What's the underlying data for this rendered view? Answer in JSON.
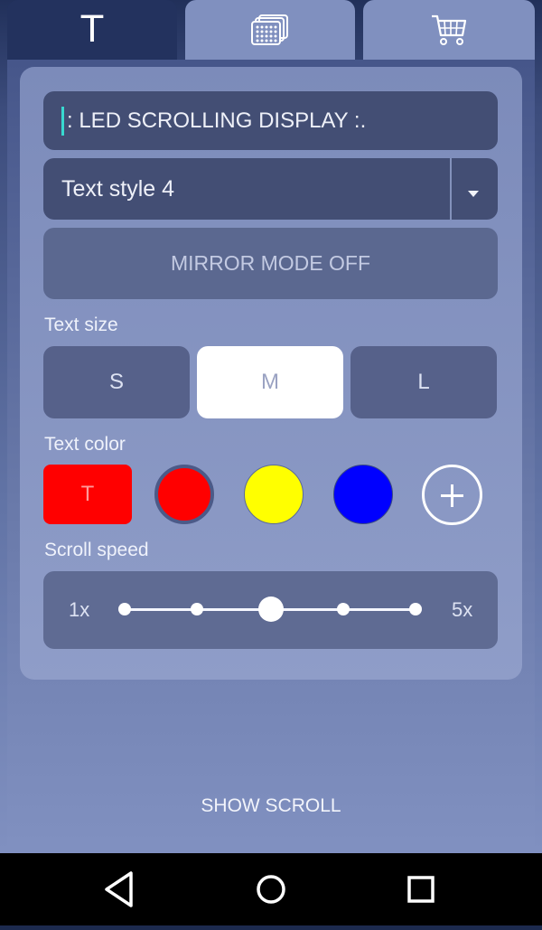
{
  "tabs": [
    {
      "label": "T",
      "icon": "text-icon",
      "active": true
    },
    {
      "label": "",
      "icon": "led-matrix-icon",
      "active": false
    },
    {
      "label": "",
      "icon": "shopping-cart-icon",
      "active": false
    }
  ],
  "message_input": {
    "value": ": LED SCROLLING DISPLAY :."
  },
  "text_style": {
    "selected": "Text style 4"
  },
  "mirror_mode": {
    "label": "MIRROR MODE OFF"
  },
  "text_size": {
    "label": "Text size",
    "options": [
      "S",
      "M",
      "L"
    ],
    "selected": "M"
  },
  "text_color": {
    "label": "Text color",
    "preview_label": "T",
    "selected": "#ff0000",
    "swatches": [
      "#ff0000",
      "#ffff00",
      "#0000ff"
    ],
    "add_icon": "plus-icon"
  },
  "scroll_speed": {
    "label": "Scroll speed",
    "min_label": "1x",
    "max_label": "5x",
    "value": 3,
    "min": 1,
    "max": 5
  },
  "show_scroll_label": "SHOW SCROLL",
  "navigation": [
    "back-icon",
    "home-icon",
    "recents-icon"
  ],
  "colors": {
    "accent": "#38d9d0",
    "tab_active": "#23325e",
    "tab_inactive": "#8090bf"
  }
}
